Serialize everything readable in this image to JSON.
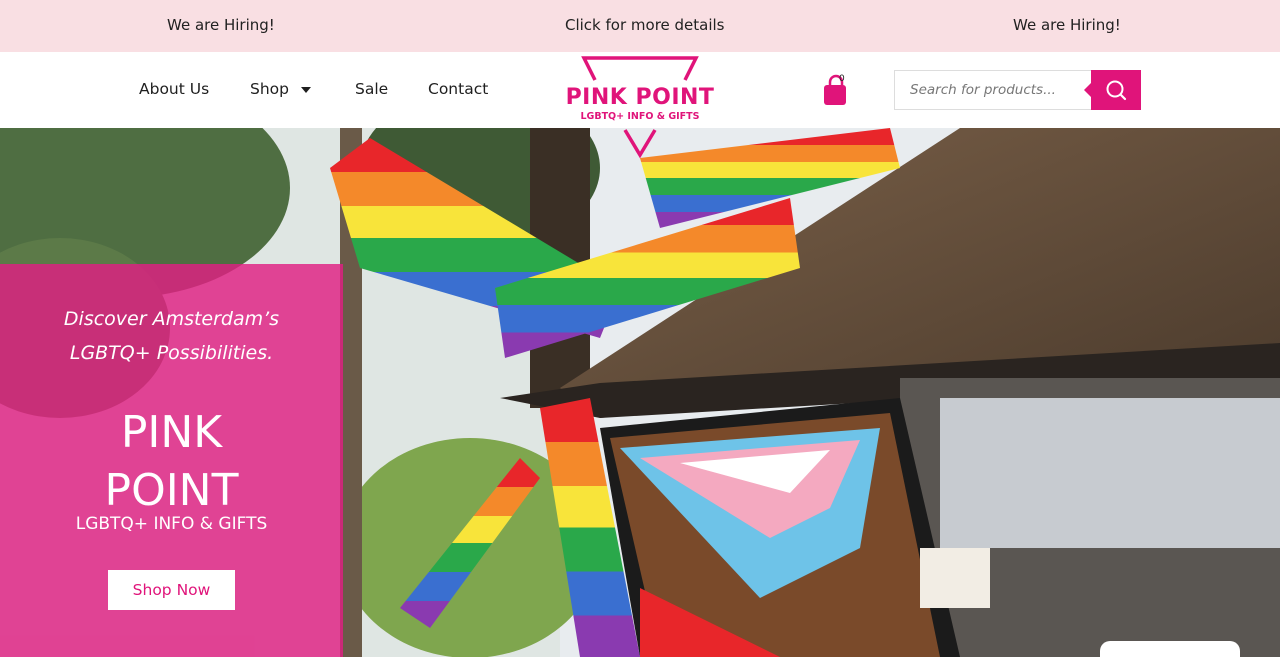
{
  "topbar": {
    "left_text": "We are Hiring!",
    "center_text": "Click for more details",
    "right_text": "We are Hiring!"
  },
  "nav": {
    "about": "About Us",
    "shop": "Shop",
    "sale": "Sale",
    "contact": "Contact"
  },
  "logo": {
    "title": "PINK POINT",
    "subtitle": "LGBTQ+ INFO & GIFTS"
  },
  "cart": {
    "count": "0",
    "icon": "shopping-bag-icon"
  },
  "search": {
    "placeholder": "Search for products...",
    "value": "",
    "icon": "search-icon"
  },
  "hero": {
    "tagline_line1": "Discover Amsterdam’s",
    "tagline_line2": "LGBTQ+ Possibilities.",
    "title_line1": "PINK",
    "title_line2": "POINT",
    "subtitle": "LGBTQ+ INFO & GIFTS",
    "cta_label": "Shop Now"
  },
  "colors": {
    "brand": "#e0147a",
    "topbar_bg": "#f9dfe3",
    "text_dark": "#1f1f1f"
  }
}
